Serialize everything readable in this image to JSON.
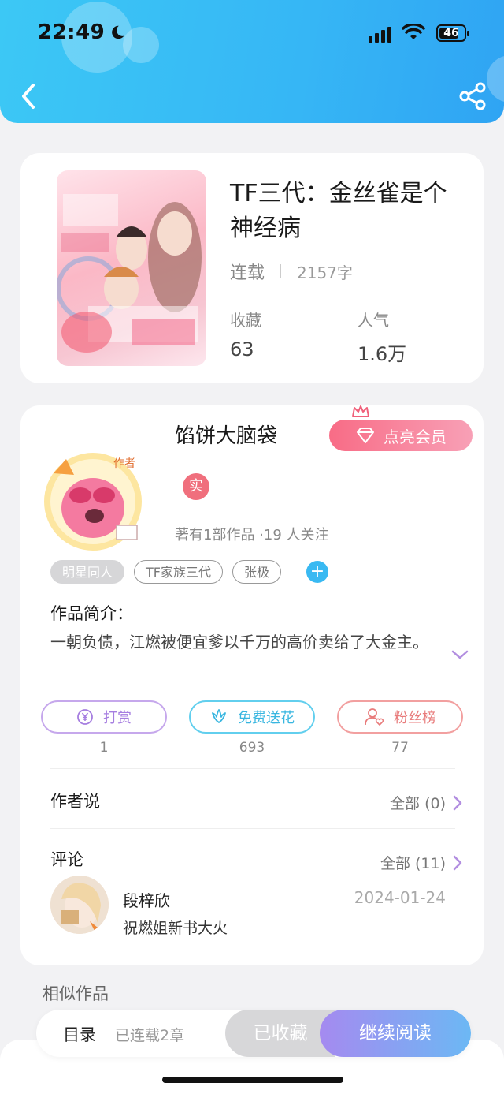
{
  "status_bar": {
    "time": "22:49",
    "battery": "46"
  },
  "book": {
    "title": "TF三代：金丝雀是个神经病",
    "status": "连载",
    "word_count": "2157字",
    "stats": [
      {
        "label": "收藏",
        "value": "63"
      },
      {
        "label": "人气",
        "value": "1.6万"
      }
    ]
  },
  "author": {
    "name": "馅饼大脑袋",
    "vip_label": "点亮会员",
    "badge": "实",
    "works_info": "著有1部作品 ·19 人关注",
    "tags": [
      "明星同人",
      "TF家族三代",
      "张极"
    ],
    "intro_label": "作品简介：",
    "intro_text": "一朝负债，江燃被便宜爹以千万的高价卖给了大金主。"
  },
  "actions": [
    {
      "label": "打赏",
      "count": "1",
      "color": "#b18ee0"
    },
    {
      "label": "免费送花",
      "count": "693",
      "color": "#4fc6e8"
    },
    {
      "label": "粉丝榜",
      "count": "77",
      "color": "#f08a8a"
    }
  ],
  "author_says": {
    "title": "作者说",
    "more": "全部 (0)"
  },
  "comments": {
    "title": "评论",
    "more": "全部 (11)",
    "items": [
      {
        "user": "段梓欣",
        "date": "2024-01-24",
        "text": "祝燃姐新书大火"
      }
    ]
  },
  "similar_title": "相似作品",
  "bottom_bar": {
    "catalog": "目录",
    "chapters": "已连载2章",
    "collected": "已收藏",
    "continue": "继续阅读"
  }
}
